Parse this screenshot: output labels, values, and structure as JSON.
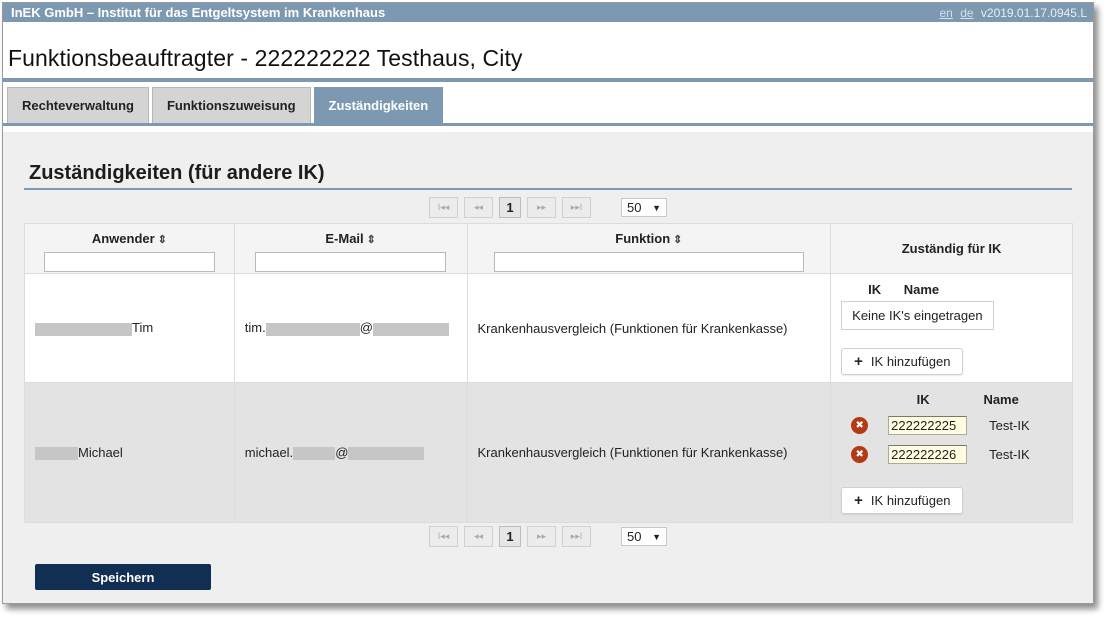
{
  "topbar": {
    "org": "InEK GmbH – Institut für das Entgeltsystem im Krankenhaus",
    "lang_en": "en",
    "lang_de": "de",
    "version": "v2019.01.17.0945.L"
  },
  "page": {
    "title": "Funktionsbeauftragter - 222222222 Testhaus, City"
  },
  "tabs": [
    {
      "label": "Rechteverwaltung",
      "active": false
    },
    {
      "label": "Funktionszuweisung",
      "active": false
    },
    {
      "label": "Zuständigkeiten",
      "active": true
    }
  ],
  "section": {
    "title": "Zuständigkeiten (für andere IK)"
  },
  "pager": {
    "first": "I◂◂",
    "prev": "◂◂",
    "page": "1",
    "next": "▸▸",
    "last": "▸▸I",
    "page_size": "50"
  },
  "columns": {
    "user": "Anwender",
    "email": "E-Mail",
    "function": "Funktion",
    "responsible": "Zuständig für IK"
  },
  "sub_columns": {
    "ik": "IK",
    "name": "Name"
  },
  "rows": [
    {
      "user_name": "Tim",
      "email_prefix": "tim.",
      "email_at": "@",
      "function": "Krankenhausvergleich (Funktionen für Krankenkasse)",
      "empty_text": "Keine IK's eingetragen",
      "add_label": "IK hinzufügen"
    },
    {
      "user_name": "Michael",
      "email_prefix": "michael.",
      "email_at": "@",
      "function": "Krankenhausvergleich (Funktionen für Krankenkasse)",
      "iks": [
        {
          "ik": "222222225",
          "name": "Test-IK"
        },
        {
          "ik": "222222226",
          "name": "Test-IK"
        }
      ],
      "add_label": "IK hinzufügen"
    }
  ],
  "actions": {
    "save": "Speichern"
  },
  "colors": {
    "accent": "#7d99b1",
    "save_bg": "#102f52",
    "trash": "#b23b12"
  }
}
